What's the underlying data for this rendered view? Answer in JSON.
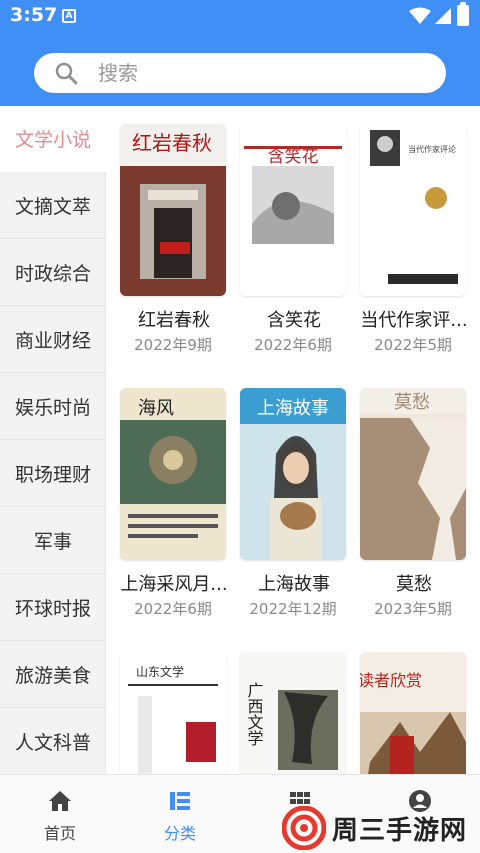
{
  "status_bar": {
    "time": "3:57",
    "notification_icon": "A"
  },
  "search": {
    "placeholder": "搜索"
  },
  "sidebar": {
    "items": [
      {
        "label": "文学小说",
        "active": true
      },
      {
        "label": "文摘文萃",
        "active": false
      },
      {
        "label": "时政综合",
        "active": false
      },
      {
        "label": "商业财经",
        "active": false
      },
      {
        "label": "娱乐时尚",
        "active": false
      },
      {
        "label": "职场理财",
        "active": false
      },
      {
        "label": "军事",
        "active": false
      },
      {
        "label": "环球时报",
        "active": false
      },
      {
        "label": "旅游美食",
        "active": false
      },
      {
        "label": "人文科普",
        "active": false
      }
    ]
  },
  "books": [
    {
      "title": "红岩春秋",
      "date": "2022年9期",
      "cover_text": "红岩春秋"
    },
    {
      "title": "含笑花",
      "date": "2022年6期",
      "cover_text": "含笑花"
    },
    {
      "title": "当代作家评...",
      "date": "2022年5期",
      "cover_text": "当代作家评论"
    },
    {
      "title": "上海采风月...",
      "date": "2022年6期",
      "cover_text": "海风"
    },
    {
      "title": "上海故事",
      "date": "2022年12期",
      "cover_text": "上海故事"
    },
    {
      "title": "莫愁",
      "date": "2023年5期",
      "cover_text": "莫愁"
    },
    {
      "title": "",
      "date": "",
      "cover_text": "山东文学"
    },
    {
      "title": "",
      "date": "",
      "cover_text": "广西文学"
    },
    {
      "title": "",
      "date": "",
      "cover_text": "读者欣赏"
    }
  ],
  "bottom_nav": {
    "tabs": [
      {
        "label": "首页",
        "icon": "home-icon"
      },
      {
        "label": "分类",
        "icon": "category-icon",
        "active": true
      },
      {
        "label": "",
        "icon": "grid-icon"
      },
      {
        "label": "",
        "icon": "profile-icon"
      }
    ]
  },
  "watermark": {
    "text": "周三手游网"
  },
  "colors": {
    "primary": "#3f8ff7",
    "active_category": "#e58c93"
  }
}
